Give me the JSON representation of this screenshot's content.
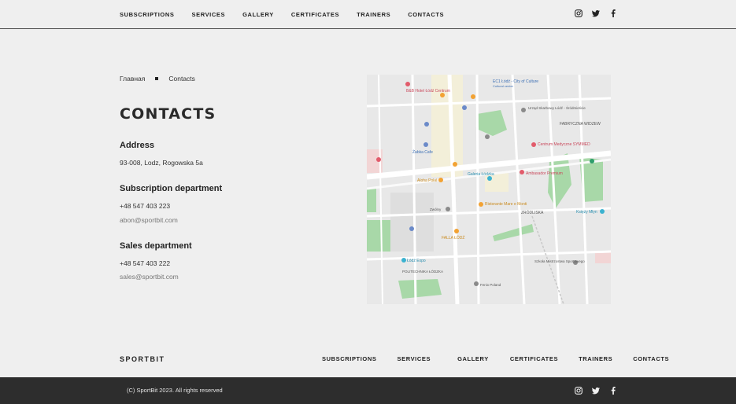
{
  "header": {
    "nav": [
      "SUBSCRIPTIONS",
      "SERVICES",
      "GALLERY",
      "CERTIFICATES",
      "TRAINERS",
      "CONTACTS"
    ]
  },
  "social_icons": [
    "instagram-icon",
    "twitter-icon",
    "facebook-icon"
  ],
  "breadcrumb": {
    "home": "Главная",
    "current": "Contacts"
  },
  "page_title": "CONTACTS",
  "address": {
    "title": "Address",
    "value": "93-008, Lodz, Rogowska 5a"
  },
  "subscription": {
    "title": "Subscription department",
    "phone": "+48 547 403 223",
    "email": "abon@sportbit.com"
  },
  "sales": {
    "title": "Sales department",
    "phone": "+48 547 403 222",
    "email": "sales@sportbit.com"
  },
  "map": {
    "labels": {
      "l1": "B&B Hotel Łódź Centrum",
      "l2": "EC1 Łódź - City of Culture",
      "l3": "Cultural center",
      "l4": "Urząd Skarbowy Łódź - Śródmieście",
      "l5": "FABRYCZNA WIDZEW",
      "l6": "Żabka Cafe",
      "l7": "Centrum Medyczne SYMMED",
      "l8": "Ambasador Premium",
      "l9": "Galeria Łódzka",
      "l10": "Ristorante Mare e Monti",
      "l11": "ZRÓDLISKA",
      "l12": "Księży Młyn",
      "l13": "Łódź Expo",
      "l14": "POLITECHNIKA ŁÓDZKA",
      "l15": "Fenix Poland",
      "l16": "Szkoła Mistrzostwa Sportowego",
      "l17": "Zwólny",
      "l18": "FALLA ŁÓDŹ",
      "l19": "Aloha Poké"
    }
  },
  "footer": {
    "brand": "SPORTBIT",
    "nav": [
      "SUBSCRIPTIONS",
      "SERVICES",
      "GALLERY",
      "CERTIFICATES",
      "TRAINERS",
      "CONTACTS"
    ],
    "copyright": "(C) SportBit 2023. All rights reserved"
  }
}
